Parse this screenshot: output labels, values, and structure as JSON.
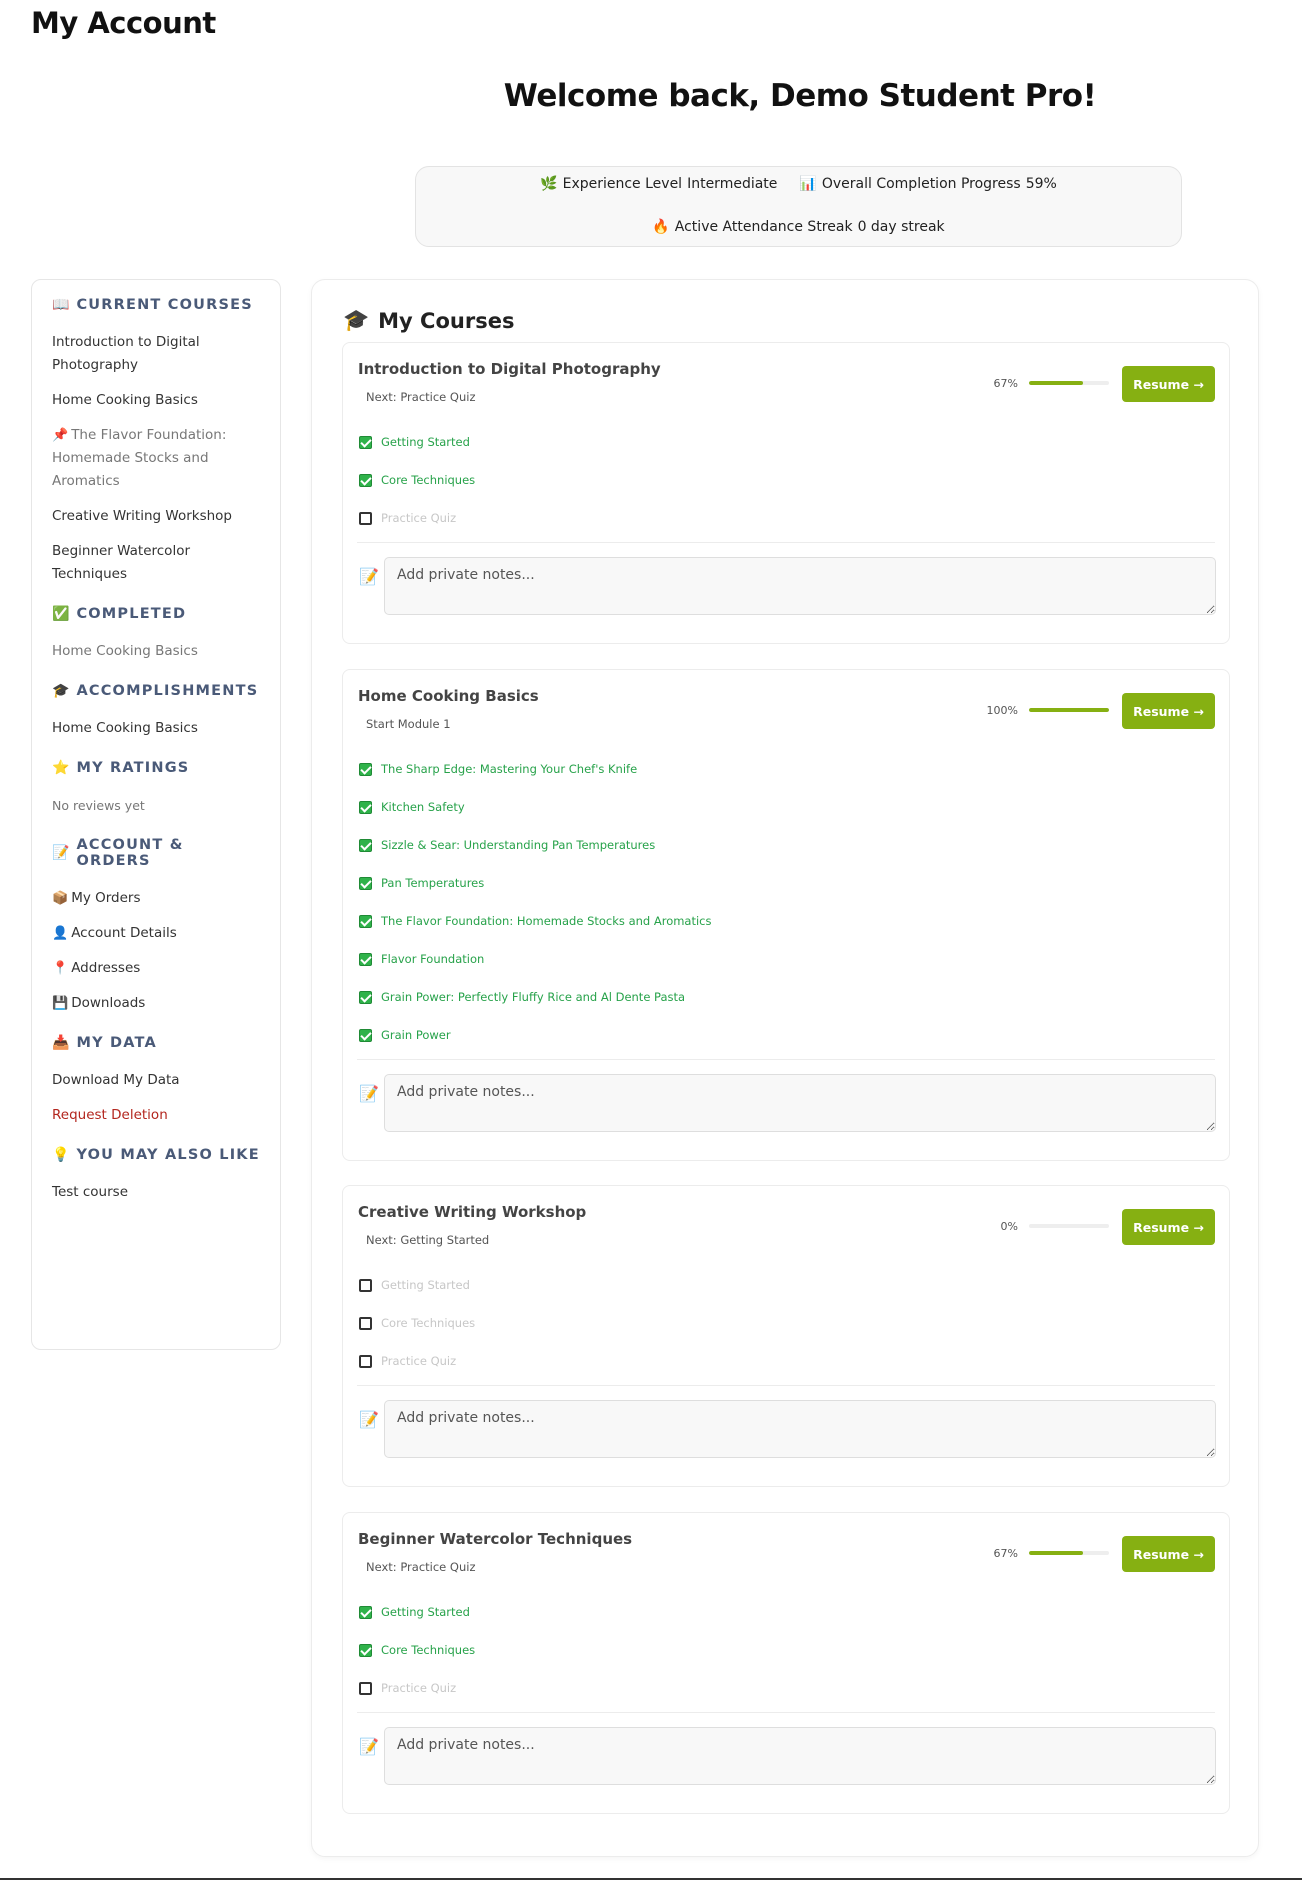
{
  "page": {
    "title": "My Account",
    "welcome": "Welcome back, Demo Student Pro!"
  },
  "stats": {
    "experience": {
      "icon": "🌿",
      "label": "Experience Level",
      "value": "Intermediate"
    },
    "progress": {
      "icon": "📊",
      "label": "Overall Completion Progress",
      "value": "59%"
    },
    "streak": {
      "icon": "🔥",
      "label": "Active Attendance Streak",
      "value": "0 day streak"
    }
  },
  "sidebar": {
    "current": {
      "icon": "📖",
      "title": "Current Courses",
      "items": [
        {
          "label": "Introduction to Digital Photography"
        },
        {
          "label": "Home Cooking Basics"
        },
        {
          "icon": "📌",
          "label": "The Flavor Foundation: Homemade Stocks and Aromatics"
        },
        {
          "label": "Creative Writing Workshop"
        },
        {
          "label": "Beginner Watercolor Techniques"
        }
      ]
    },
    "completed": {
      "icon": "✅",
      "title": "Completed",
      "items": [
        "Home Cooking Basics"
      ]
    },
    "accomplishments": {
      "icon": "🎓",
      "title": "Accomplishments",
      "items": [
        "Home Cooking Basics"
      ]
    },
    "ratings": {
      "icon": "⭐",
      "title": "My Ratings",
      "empty": "No reviews yet"
    },
    "account": {
      "icon": "📝",
      "title": "Account & Orders",
      "items": [
        {
          "icon": "📦",
          "label": "My Orders"
        },
        {
          "icon": "👤",
          "label": "Account Details"
        },
        {
          "icon": "📍",
          "label": "Addresses"
        },
        {
          "icon": "💾",
          "label": "Downloads"
        }
      ]
    },
    "mydata": {
      "icon": "📥",
      "title": "My Data",
      "download": "Download My Data",
      "delete": "Request Deletion"
    },
    "suggest": {
      "icon": "💡",
      "title": "You May Also Like",
      "items": [
        "Test course"
      ]
    }
  },
  "main": {
    "icon": "🎓",
    "title": "My Courses",
    "resume_label": "Resume →",
    "notes_icon": "📝",
    "notes_placeholder": "Add private notes...",
    "courses": [
      {
        "title": "Introduction to Digital Photography",
        "next": "Next: Practice Quiz",
        "progress_text": "67%",
        "progress": 0.67,
        "lessons": [
          {
            "label": "Getting Started",
            "done": true
          },
          {
            "label": "Core Techniques",
            "done": true
          },
          {
            "label": "Practice Quiz",
            "done": false
          }
        ]
      },
      {
        "title": "Home Cooking Basics",
        "next": "Start Module 1",
        "progress_text": "100%",
        "progress": 1.0,
        "lessons": [
          {
            "label": "The Sharp Edge: Mastering Your Chef's Knife",
            "done": true
          },
          {
            "label": "Kitchen Safety",
            "done": true
          },
          {
            "label": "Sizzle & Sear: Understanding Pan Temperatures",
            "done": true
          },
          {
            "label": "Pan Temperatures",
            "done": true
          },
          {
            "label": "The Flavor Foundation: Homemade Stocks and Aromatics",
            "done": true
          },
          {
            "label": "Flavor Foundation",
            "done": true
          },
          {
            "label": "Grain Power: Perfectly Fluffy Rice and Al Dente Pasta",
            "done": true
          },
          {
            "label": "Grain Power",
            "done": true
          }
        ]
      },
      {
        "title": "Creative Writing Workshop",
        "next": "Next: Getting Started",
        "progress_text": "0%",
        "progress": 0.0,
        "lessons": [
          {
            "label": "Getting Started",
            "done": false
          },
          {
            "label": "Core Techniques",
            "done": false
          },
          {
            "label": "Practice Quiz",
            "done": false
          }
        ]
      },
      {
        "title": "Beginner Watercolor Techniques",
        "next": "Next: Practice Quiz",
        "progress_text": "67%",
        "progress": 0.67,
        "lessons": [
          {
            "label": "Getting Started",
            "done": true
          },
          {
            "label": "Core Techniques",
            "done": true
          },
          {
            "label": "Practice Quiz",
            "done": false
          }
        ]
      }
    ]
  }
}
